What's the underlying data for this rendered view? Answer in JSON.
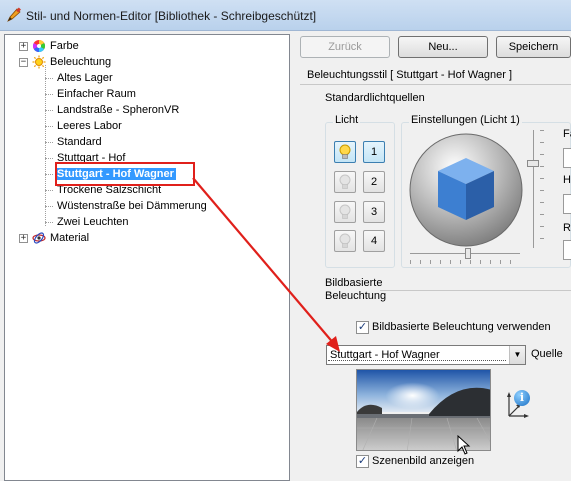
{
  "window": {
    "title": "Stil- und Normen-Editor [Bibliothek - Schreibgeschützt]"
  },
  "tree": {
    "nodes": [
      {
        "label": "Farbe",
        "expander": "+",
        "icon": "color-wheel-icon"
      },
      {
        "label": "Beleuchtung",
        "expander": "−",
        "icon": "sun-icon"
      },
      {
        "label": "Material",
        "expander": "+",
        "icon": "material-icon"
      }
    ],
    "lighting_children": [
      "Altes Lager",
      "Einfacher Raum",
      "Landstraße - SpheronVR",
      "Leeres Labor",
      "Standard",
      "Stuttgart - Hof",
      "Stuttgart - Hof Wagner",
      "Trockene Salzschicht",
      "Wüstenstraße bei Dämmerung",
      "Zwei Leuchten"
    ],
    "selected": "Stuttgart - Hof Wagner"
  },
  "toolbar": {
    "back_label": "Zurück",
    "new_label": "Neu...",
    "save_label": "Speichern"
  },
  "style": {
    "header": "Beleuchtungsstil [ Stuttgart - Hof Wagner ]",
    "standard_lights_label": "Standardlichtquellen",
    "light_group_label": "Licht",
    "settings_group_label": "Einstellungen (Licht 1)",
    "light_numbers": [
      "1",
      "2",
      "3",
      "4"
    ],
    "active_light": "1",
    "right_cut_labels": [
      "Fa",
      "H",
      "R"
    ]
  },
  "ibl": {
    "section_label_line1": "Bildbasierte",
    "section_label_line2": "Beleuchtung",
    "use_ibl_label": "Bildbasierte Beleuchtung verwenden",
    "use_ibl_checked": "✓",
    "source_value": "Stuttgart - Hof Wagner",
    "source_label": "Quelle",
    "show_scene_label": "Szenenbild anzeigen",
    "show_scene_checked": "✓",
    "info_symbol": "i"
  },
  "colors": {
    "annotation": "#e0201b",
    "selection": "#3399ff",
    "sphere_cube": "#3d7fd1"
  }
}
